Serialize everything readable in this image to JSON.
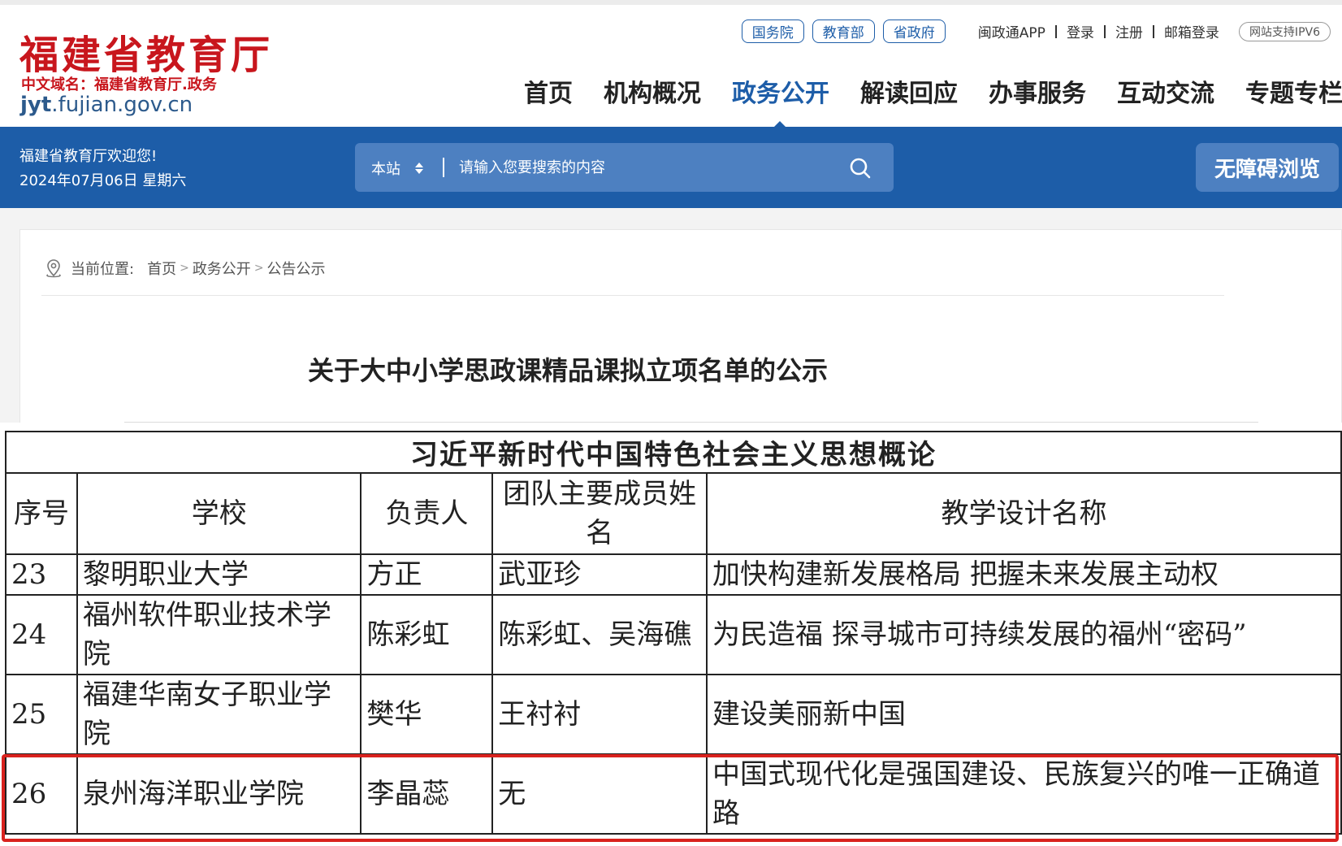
{
  "logo": {
    "title": "福建省教育厅",
    "subtitle": "中文域名：福建省教育厅.政务",
    "domain_bold": "jyt",
    "domain_rest": ".fujian.gov.cn"
  },
  "toplinks": {
    "pills": [
      "国务院",
      "教育部",
      "省政府"
    ],
    "links": [
      "闽政通APP",
      "登录",
      "注册",
      "邮箱登录"
    ],
    "ipv6": "网站支持IPV6"
  },
  "nav": {
    "items": [
      "首页",
      "机构概况",
      "政务公开",
      "解读回应",
      "办事服务",
      "互动交流",
      "专题专栏"
    ],
    "active_index": 2
  },
  "banner": {
    "welcome": "福建省教育厅欢迎您!",
    "date": "2024年07月06日 星期六",
    "search_scope": "本站",
    "search_placeholder": "请输入您要搜索的内容",
    "accessibility": "无障碍浏览"
  },
  "breadcrumb": {
    "label": "当前位置:",
    "items": [
      "首页",
      "政务公开",
      "公告公示"
    ]
  },
  "article": {
    "title": "关于大中小学思政课精品课拟立项名单的公示"
  },
  "table": {
    "caption": "习近平新时代中国特色社会主义思想概论",
    "headers": [
      "序号",
      "学校",
      "负责人",
      "团队主要成员姓名",
      "教学设计名称"
    ],
    "rows": [
      {
        "no": "23",
        "school": "黎明职业大学",
        "leader": "方正",
        "members": "武亚珍",
        "design": "加快构建新发展格局 把握未来发展主动权"
      },
      {
        "no": "24",
        "school": "福州软件职业技术学院",
        "leader": "陈彩虹",
        "members": "陈彩虹、吴海礁",
        "design": "为民造福 探寻城市可持续发展的福州“密码”"
      },
      {
        "no": "25",
        "school": "福建华南女子职业学院",
        "leader": "樊华",
        "members": "王衬衬",
        "design": "建设美丽新中国"
      },
      {
        "no": "26",
        "school": "泉州海洋职业学院",
        "leader": "李晶蕊",
        "members": "无",
        "design": "中国式现代化是强国建设、民族复兴的唯一正确道路"
      }
    ]
  },
  "colors": {
    "brand_red": "#c8161d",
    "brand_blue": "#1d5da8",
    "highlight_red": "#d9221e"
  }
}
